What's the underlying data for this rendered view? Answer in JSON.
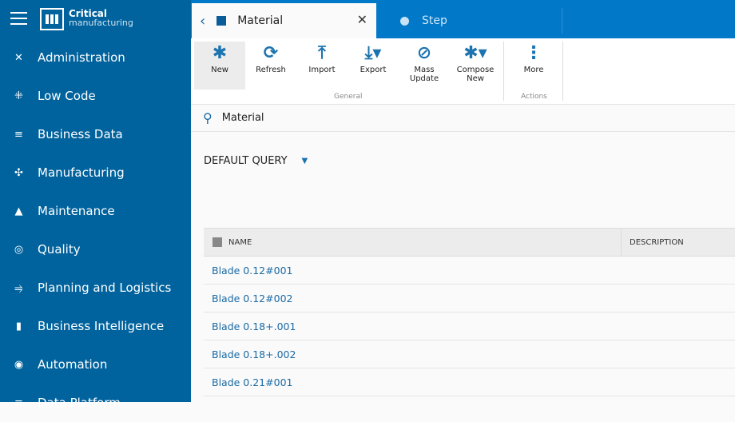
{
  "brand": {
    "line1": "Critical",
    "line2": "manufacturing"
  },
  "sidebar": {
    "items": [
      {
        "label": "Administration",
        "icon": "✕"
      },
      {
        "label": "Low Code",
        "icon": "⁜"
      },
      {
        "label": "Business Data",
        "icon": "≡"
      },
      {
        "label": "Manufacturing",
        "icon": "✣"
      },
      {
        "label": "Maintenance",
        "icon": "▲"
      },
      {
        "label": "Quality",
        "icon": "◎"
      },
      {
        "label": "Planning and Logistics",
        "icon": "⥤"
      },
      {
        "label": "Business Intelligence",
        "icon": "▮"
      },
      {
        "label": "Automation",
        "icon": "◉"
      },
      {
        "label": "Data Platform",
        "icon": "≡"
      }
    ]
  },
  "tabs": {
    "active": "Material",
    "back": "‹",
    "close": "✕",
    "second": "Step"
  },
  "ribbon": {
    "buttons": [
      {
        "label": "New",
        "icon": "✱"
      },
      {
        "label": "Refresh",
        "icon": "⟳"
      },
      {
        "label": "Import",
        "icon": "⤒"
      },
      {
        "label": "Export",
        "icon": "⤓▾"
      },
      {
        "label": "Mass Update",
        "icon": "⊘"
      },
      {
        "label": "Compose New",
        "icon": "✱▾"
      },
      {
        "label": "More",
        "icon": "⋮"
      }
    ],
    "groups": [
      "General",
      "Actions"
    ]
  },
  "search": {
    "value": "Material",
    "icon": "⚲"
  },
  "query": {
    "label": "DEFAULT QUERY",
    "caret": "▼"
  },
  "table": {
    "columns": [
      "NAME",
      "DESCRIPTION"
    ],
    "rows": [
      "Blade 0.12#001",
      "Blade 0.12#002",
      "Blade 0.18+.001",
      "Blade 0.18+.002",
      "Blade 0.21#001"
    ]
  }
}
